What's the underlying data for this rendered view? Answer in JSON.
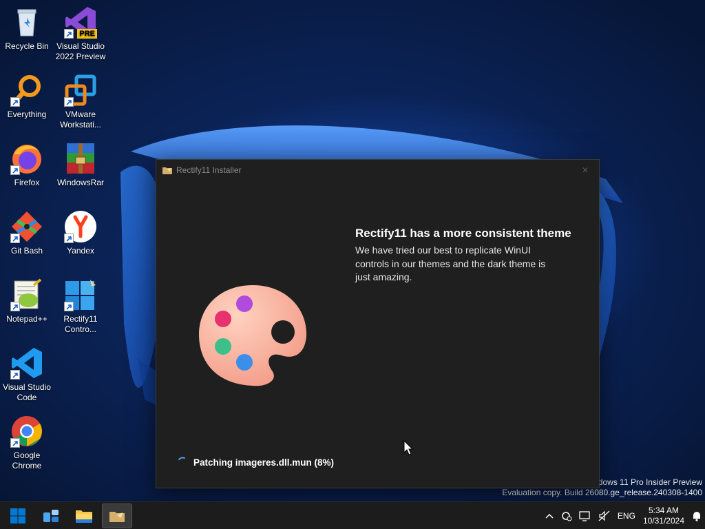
{
  "desktop": {
    "icons": [
      {
        "label": "Recycle Bin",
        "icon": "recycle-bin-icon"
      },
      {
        "label": "Visual Studio 2022 Preview",
        "icon": "visual-studio-preview-icon",
        "badge": "PRE"
      },
      {
        "label": "Everything",
        "icon": "everything-search-icon"
      },
      {
        "label": "VMware Workstati...",
        "icon": "vmware-icon"
      },
      {
        "label": "Firefox",
        "icon": "firefox-icon"
      },
      {
        "label": "WindowsRar",
        "icon": "winrar-icon"
      },
      {
        "label": "Git Bash",
        "icon": "git-bash-icon"
      },
      {
        "label": "Yandex",
        "icon": "yandex-icon"
      },
      {
        "label": "Notepad++",
        "icon": "notepad-plus-plus-icon"
      },
      {
        "label": "Rectify11 Contro...",
        "icon": "rectify11-control-icon"
      },
      {
        "label": "Visual Studio Code",
        "icon": "vscode-icon"
      },
      {
        "label": "Google Chrome",
        "icon": "chrome-icon"
      }
    ]
  },
  "installer": {
    "title": "Rectify11 Installer",
    "heading": "Rectify11 has a more consistent theme",
    "description": "We have tried our best to replicate WinUI controls in our themes and the dark theme is just amazing.",
    "progress_text": "Patching imageres.dll.mun (8%)",
    "progress_percent": 8
  },
  "watermark": {
    "line1": "ndows 11 Pro Insider Preview",
    "line2": "Evaluation copy. Build 26080.ge_release.240308-1400"
  },
  "taskbar": {
    "items": [
      "start-icon",
      "widgets-icon",
      "file-explorer-icon",
      "rectify11-installer-icon"
    ],
    "tray": {
      "language": "ENG",
      "time": "5:34 AM",
      "date": "10/31/2024"
    }
  },
  "colors": {
    "window_bg": "#1f1f1f",
    "taskbar_bg": "#1c1c1c",
    "accent": "#0078d4"
  }
}
